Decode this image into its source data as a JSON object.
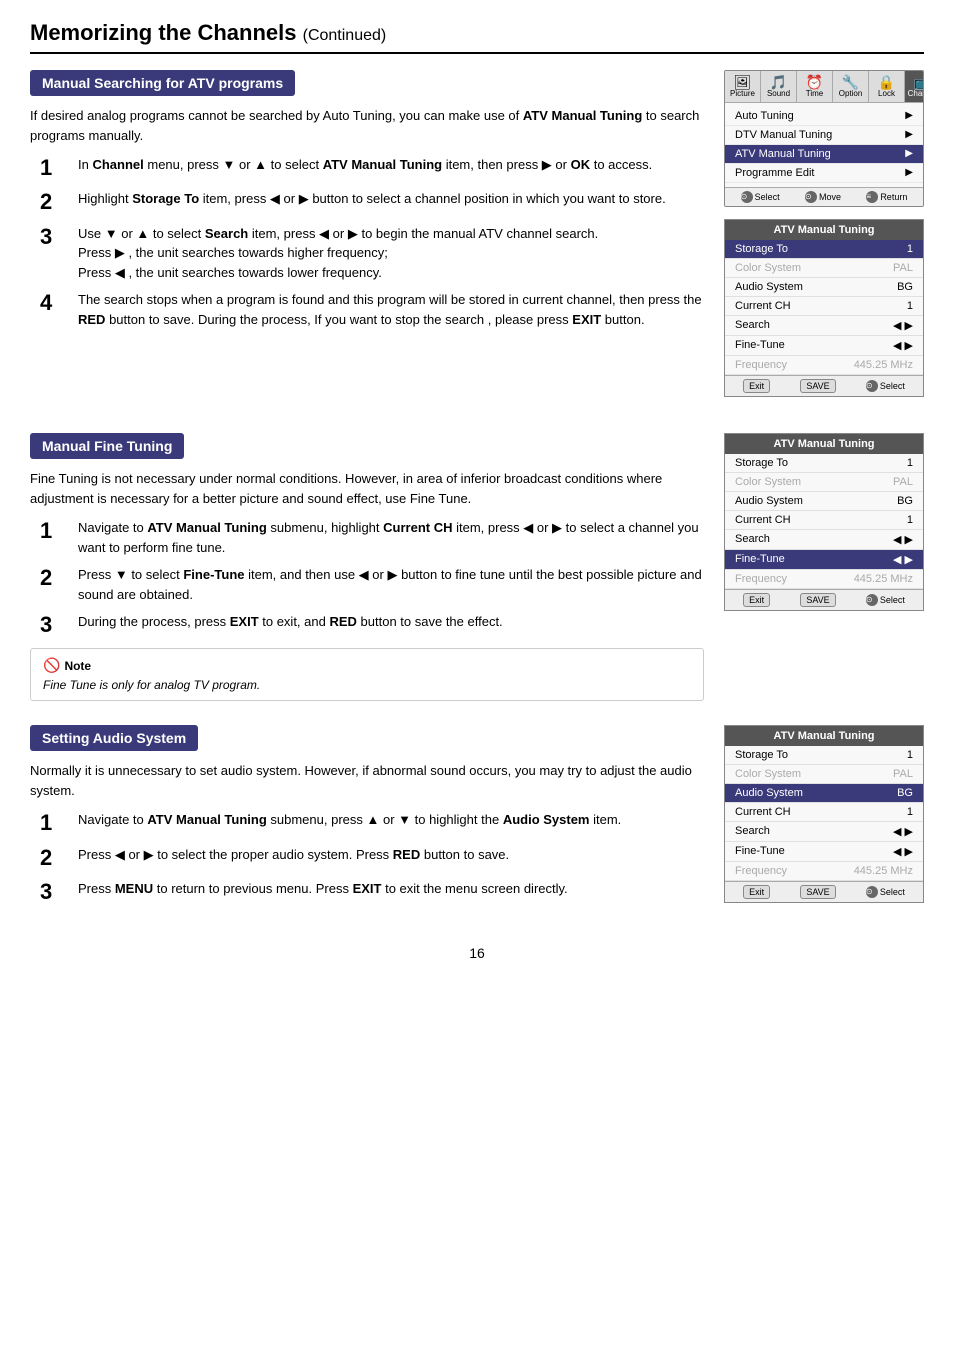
{
  "page": {
    "title": "Memorizing the Channels",
    "title_suffix": "(Continued)",
    "page_number": "16"
  },
  "sections": {
    "manual_atv": {
      "header": "Manual Searching for ATV programs",
      "desc": "If desired analog programs cannot be searched by Auto Tuning, you can make use of ATV Manual Tuning to search programs manually.",
      "steps": [
        {
          "num": "1",
          "text": "In Channel menu, press ▼ or ▲ to select ATV Manual Tuning item, then press ▶ or OK to access."
        },
        {
          "num": "2",
          "text": "Highlight Storage To item, press ◀ or ▶ button to select a channel position in which you want to store."
        },
        {
          "num": "3",
          "text": "Use ▼ or ▲ to select Search item, press ◀ or ▶ to begin the manual ATV channel search.",
          "sub": [
            "Press ▶ , the unit searches towards higher frequency;",
            "Press ◀ , the unit searches towards lower frequency."
          ]
        },
        {
          "num": "4",
          "text": "The search stops when a program is found and this program will be stored in current channel, then press the RED button to save. During the process, If you want to stop the search , please press EXIT button."
        }
      ]
    },
    "manual_fine": {
      "header": "Manual Fine Tuning",
      "desc": "Fine Tuning is not necessary under normal conditions. However, in area of inferior broadcast conditions where adjustment is necessary for a better picture and sound effect, use Fine Tune.",
      "steps": [
        {
          "num": "1",
          "text": "Navigate to ATV Manual Tuning submenu, highlight Current CH item, press ◀ or ▶ to select a channel you want to perform fine tune."
        },
        {
          "num": "2",
          "text": "Press ▼ to select Fine-Tune item, and then use ◀ or ▶ button to fine tune until the best possible picture and sound are obtained."
        },
        {
          "num": "3",
          "text": "During the process, press EXIT to exit, and RED button to save the effect."
        }
      ],
      "note_title": "Note",
      "note_text": "Fine Tune is only for analog TV program."
    },
    "setting_audio": {
      "header": "Setting Audio System",
      "desc": "Normally it is unnecessary to set audio system. However, if abnormal sound occurs, you may try to adjust the audio system.",
      "steps": [
        {
          "num": "1",
          "text": "Navigate to ATV Manual Tuning submenu, press ▲ or ▼ to highlight the Audio System item."
        },
        {
          "num": "2",
          "text": "Press ◀ or ▶ to select the proper audio system. Press RED button to save."
        },
        {
          "num": "3",
          "text": "Press MENU to return to previous menu. Press EXIT to exit the menu screen directly."
        }
      ]
    }
  },
  "top_menu_screenshot": {
    "title": "",
    "tabs": [
      {
        "label": "Picture",
        "icon": "🖼",
        "active": false
      },
      {
        "label": "Sound",
        "icon": "🔊",
        "active": false
      },
      {
        "label": "Time",
        "icon": "⏰",
        "active": false
      },
      {
        "label": "Option",
        "icon": "🔧",
        "active": false
      },
      {
        "label": "Lock",
        "icon": "🔒",
        "active": false
      },
      {
        "label": "Channel",
        "icon": "📺",
        "active": true
      }
    ],
    "rows": [
      {
        "label": "Auto Tuning",
        "value": "",
        "has_arrow": true,
        "highlighted": false
      },
      {
        "label": "DTV Manual Tuning",
        "value": "",
        "has_arrow": true,
        "highlighted": false
      },
      {
        "label": "ATV Manual Tuning",
        "value": "",
        "has_arrow": true,
        "highlighted": true
      },
      {
        "label": "Programme Edit",
        "value": "",
        "has_arrow": true,
        "highlighted": false
      }
    ],
    "footer": [
      {
        "icon": "⊙",
        "label": "Select"
      },
      {
        "icon": "⊙",
        "label": "Move"
      },
      {
        "icon": "▤",
        "label": "Return"
      }
    ]
  },
  "atv_panel_1": {
    "title": "ATV Manual Tuning",
    "rows": [
      {
        "label": "Storage To",
        "value": "1",
        "grayed": false,
        "highlighted": true,
        "arrows": false
      },
      {
        "label": "Color System",
        "value": "PAL",
        "grayed": true,
        "highlighted": false,
        "arrows": false
      },
      {
        "label": "Audio System",
        "value": "BG",
        "grayed": false,
        "highlighted": false,
        "arrows": false
      },
      {
        "label": "Current CH",
        "value": "1",
        "grayed": false,
        "highlighted": false,
        "arrows": false
      },
      {
        "label": "Search",
        "value": "◀ ▶",
        "grayed": false,
        "highlighted": false,
        "arrows": true
      },
      {
        "label": "Fine-Tune",
        "value": "◀ ▶",
        "grayed": false,
        "highlighted": false,
        "arrows": true
      },
      {
        "label": "Frequency",
        "value": "445.25 MHz",
        "grayed": true,
        "highlighted": false,
        "arrows": false
      }
    ],
    "footer_btns": [
      "Exit",
      "SAVE"
    ],
    "footer_select": "Select"
  },
  "atv_panel_2": {
    "title": "ATV Manual Tuning",
    "rows": [
      {
        "label": "Storage To",
        "value": "1",
        "grayed": false,
        "highlighted": false,
        "arrows": false
      },
      {
        "label": "Color System",
        "value": "PAL",
        "grayed": true,
        "highlighted": false,
        "arrows": false
      },
      {
        "label": "Audio System",
        "value": "BG",
        "grayed": false,
        "highlighted": false,
        "arrows": false
      },
      {
        "label": "Current CH",
        "value": "1",
        "grayed": false,
        "highlighted": false,
        "arrows": false
      },
      {
        "label": "Search",
        "value": "◀ ▶",
        "grayed": false,
        "highlighted": false,
        "arrows": true
      },
      {
        "label": "Fine-Tune",
        "value": "◀ ▶",
        "grayed": false,
        "highlighted": true,
        "arrows": true
      },
      {
        "label": "Frequency",
        "value": "445.25 MHz",
        "grayed": true,
        "highlighted": false,
        "arrows": false
      }
    ],
    "footer_btns": [
      "Exit",
      "SAVE"
    ],
    "footer_select": "Select"
  },
  "atv_panel_3": {
    "title": "ATV Manual Tuning",
    "rows": [
      {
        "label": "Storage To",
        "value": "1",
        "grayed": false,
        "highlighted": false,
        "arrows": false
      },
      {
        "label": "Color System",
        "value": "PAL",
        "grayed": true,
        "highlighted": false,
        "arrows": false
      },
      {
        "label": "Audio System",
        "value": "BG",
        "grayed": false,
        "highlighted": true,
        "arrows": false
      },
      {
        "label": "Current CH",
        "value": "1",
        "grayed": false,
        "highlighted": false,
        "arrows": false
      },
      {
        "label": "Search",
        "value": "◀ ▶",
        "grayed": false,
        "highlighted": false,
        "arrows": true
      },
      {
        "label": "Fine-Tune",
        "value": "◀ ▶",
        "grayed": false,
        "highlighted": false,
        "arrows": true
      },
      {
        "label": "Frequency",
        "value": "445.25 MHz",
        "grayed": true,
        "highlighted": false,
        "arrows": false
      }
    ],
    "footer_btns": [
      "Exit",
      "SAVE"
    ],
    "footer_select": "Select"
  }
}
